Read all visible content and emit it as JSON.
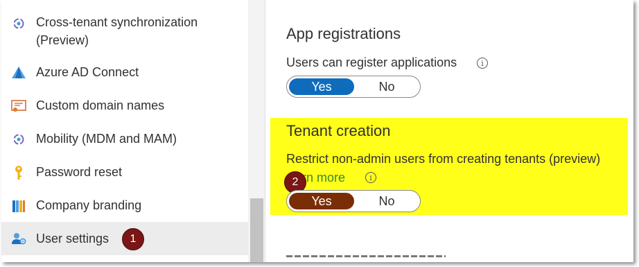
{
  "sidebar": {
    "items": [
      {
        "label_line1": "Cross-tenant synchronization",
        "label_line2": "(Preview)",
        "icon": "sync-icon"
      },
      {
        "label": "Azure AD Connect",
        "icon": "azure-ad-connect-icon"
      },
      {
        "label": "Custom domain names",
        "icon": "domain-certificate-icon"
      },
      {
        "label": "Mobility (MDM and MAM)",
        "icon": "mobility-icon"
      },
      {
        "label": "Password reset",
        "icon": "key-icon"
      },
      {
        "label": "Company branding",
        "icon": "branding-icon"
      },
      {
        "label": "User settings",
        "icon": "user-settings-icon",
        "selected": true
      }
    ],
    "badge": "1"
  },
  "app_registrations": {
    "title": "App registrations",
    "setting_label": "Users can register applications",
    "toggle": {
      "yes": "Yes",
      "no": "No",
      "selected": "Yes"
    }
  },
  "tenant_creation": {
    "title": "Tenant creation",
    "setting_label": "Restrict non-admin users from creating tenants (preview)",
    "learn_more_visible": "rn more",
    "badge": "2",
    "toggle": {
      "yes": "Yes",
      "no": "No",
      "selected": "Yes"
    }
  },
  "colors": {
    "accent": "#0f6cbd",
    "highlight": "#ffff1a",
    "badge": "#7a1616"
  }
}
